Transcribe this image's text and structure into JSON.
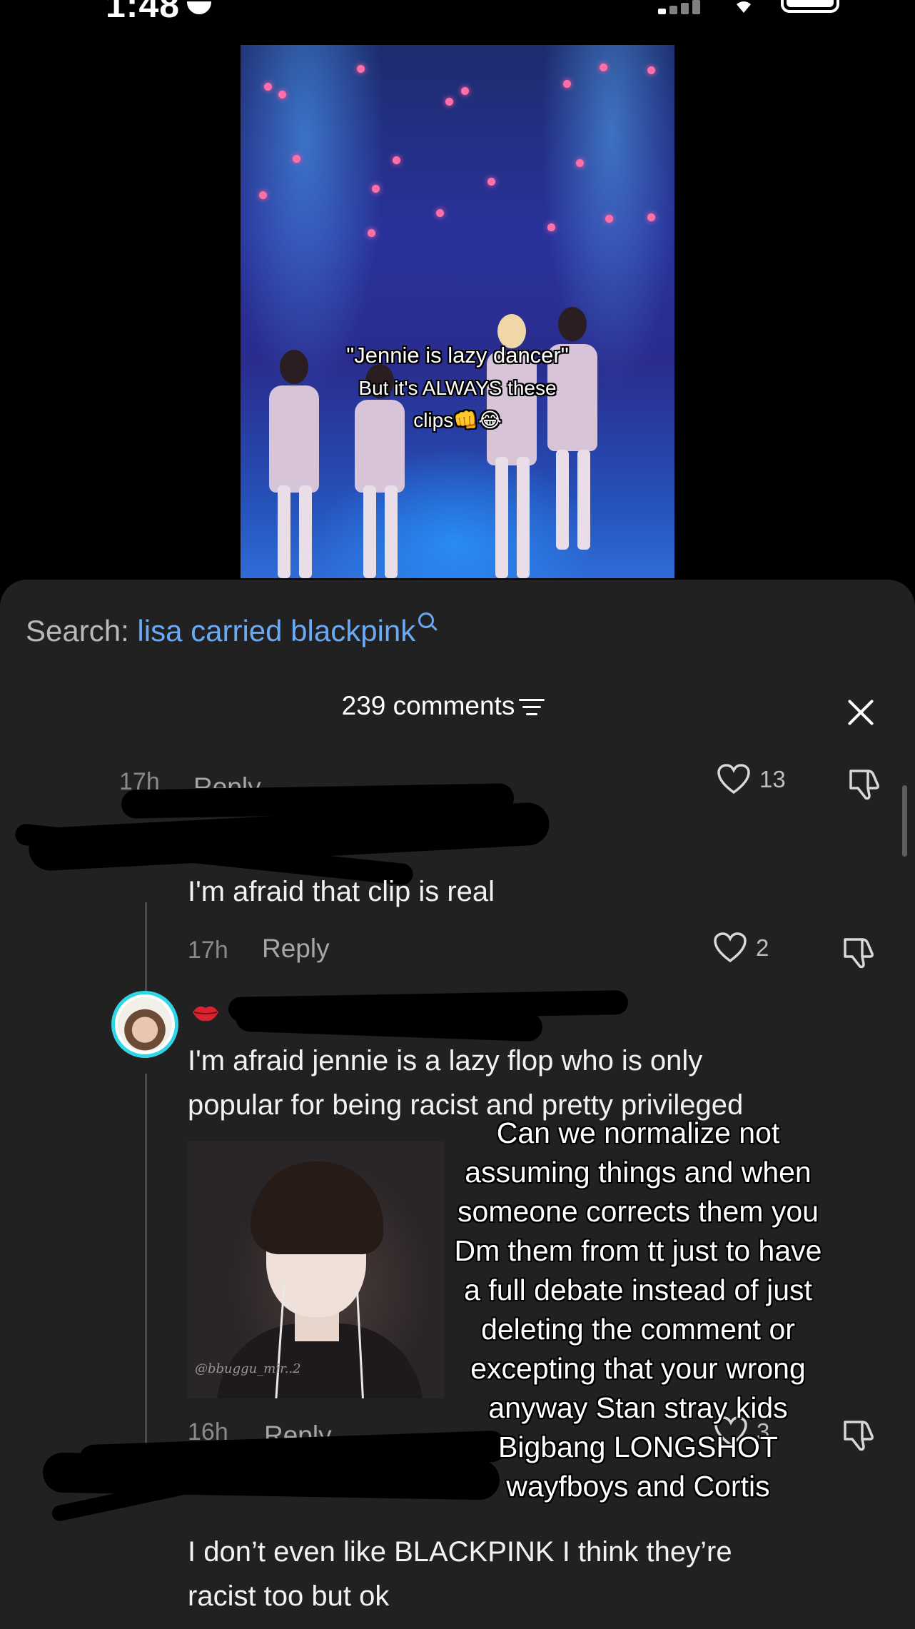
{
  "status_bar": {
    "time": "1:48"
  },
  "video": {
    "caption_line1": "\"Jennie is lazy dancer\"",
    "caption_line2": "But it's ALWAYS these",
    "caption_line3": "clips",
    "caption_emojis": "👊😂"
  },
  "search": {
    "label": "Search:",
    "term": "lisa carried blackpink"
  },
  "header": {
    "comment_count": "239 comments"
  },
  "comments": [
    {
      "time": "17h",
      "reply": "Reply",
      "likes": "13",
      "text": ""
    },
    {
      "time": "17h",
      "reply": "Reply",
      "likes": "2",
      "text": "I'm afraid that clip is real"
    },
    {
      "time": "16h",
      "reply": "Reply",
      "likes": "3",
      "text_line1": "I'm afraid jennie is a lazy flop who is only",
      "text_line2": "popular for being racist and pretty privileged",
      "photo_watermark": "@bbuggu_mir..2"
    },
    {
      "text_line1": "I don’t even like BLACKPINK I think they’re",
      "text_line2": "racist too but ok"
    }
  ],
  "overlay": {
    "lines": [
      "Can we normalize not",
      "assuming things and when",
      "someone corrects them you",
      "Dm them from tt just to have",
      "a full debate instead of just",
      "deleting the comment or",
      "excepting that your wrong",
      "anyway Stan stray kids",
      "Bigbang LONGSHOT",
      "wayfboys and Cortis"
    ]
  },
  "colors": {
    "sheet": "#212121",
    "search_accent": "#6aa9f5",
    "avatar_ring": "#2fd6e5"
  }
}
